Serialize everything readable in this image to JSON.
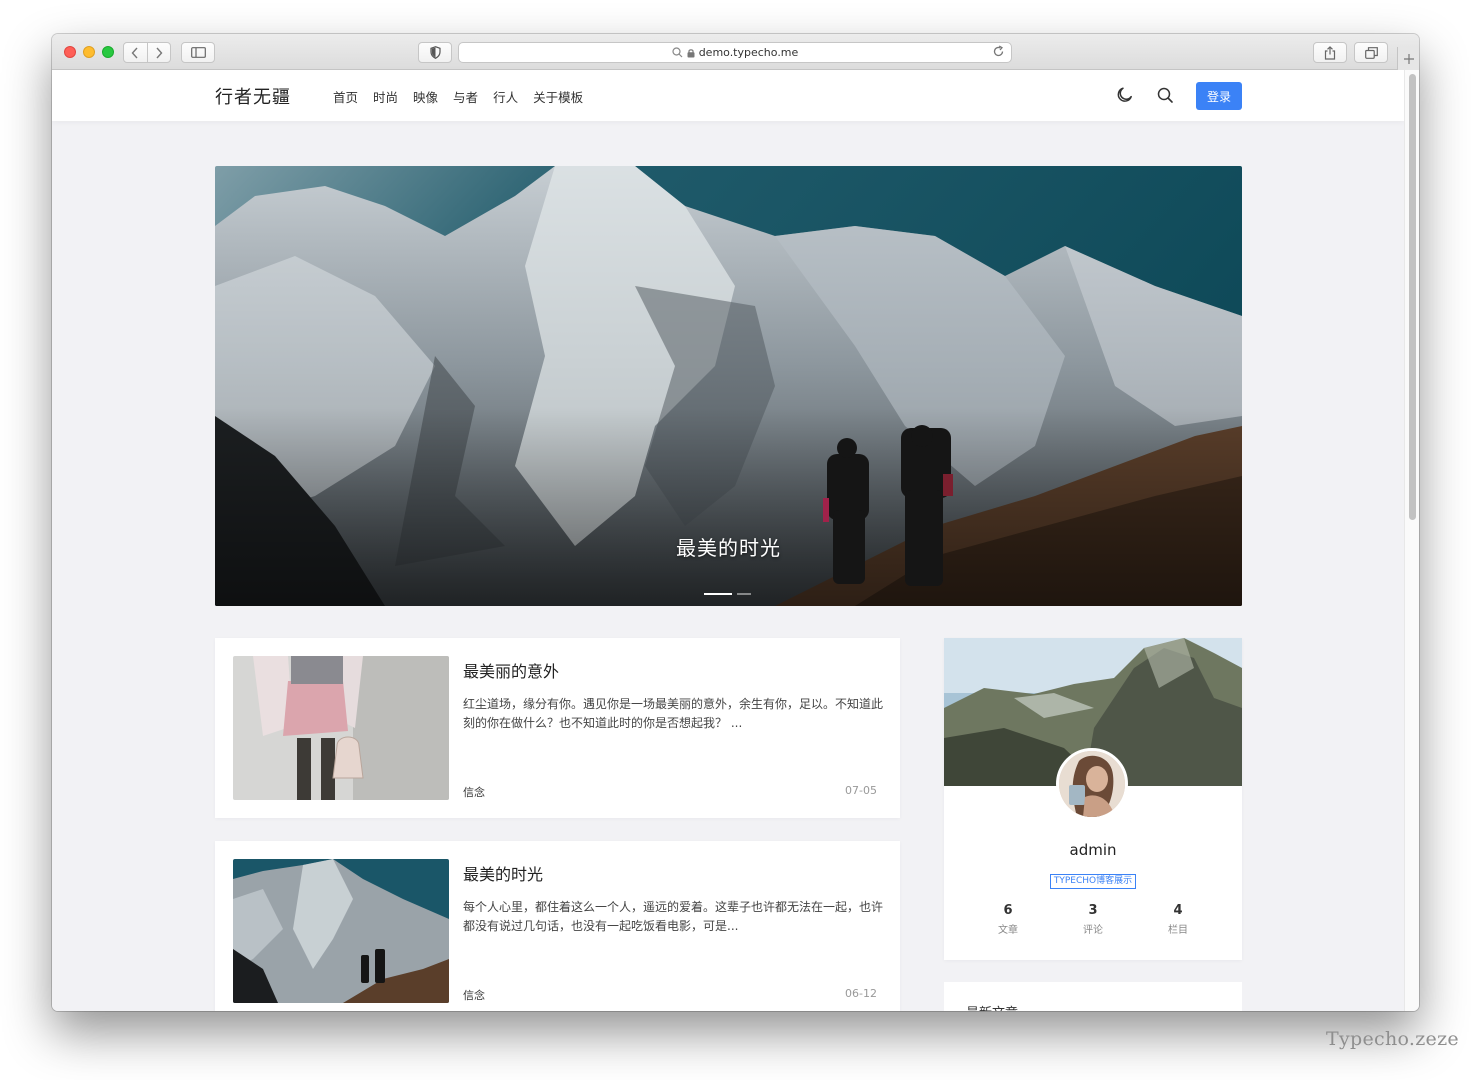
{
  "browser": {
    "url": "demo.typecho.me",
    "icons": [
      "back-icon",
      "forward-icon",
      "sidebar-icon",
      "shield-icon",
      "search-icon",
      "lock-icon",
      "reload-icon",
      "share-icon",
      "tabs-icon",
      "plus-icon"
    ]
  },
  "site": {
    "logo": "行者无疆",
    "nav": [
      "首页",
      "时尚",
      "映像",
      "与者",
      "行人",
      "关于模板"
    ],
    "login_label": "登录",
    "accent_color": "#3b82f6"
  },
  "hero": {
    "title": "最美的时光",
    "slide_count": 2,
    "active_slide": 1
  },
  "posts": [
    {
      "title": "最美丽的意外",
      "excerpt": "红尘道场，缘分有你。遇见你是一场最美丽的意外，余生有你，足以。不知道此刻的你在做什么？也不知道此时的你是否想起我？ ...",
      "tag": "信念",
      "date": "07-05"
    },
    {
      "title": "最美的时光",
      "excerpt": "每个人心里，都住着这么一个人，遥远的爱着。这辈子也许都无法在一起，也许都没有说过几句话，也没有一起吃饭看电影，可是...",
      "tag": "信念",
      "date": "06-12"
    }
  ],
  "profile": {
    "name": "admin",
    "badge": "TYPECHO博客展示",
    "stats": [
      {
        "value": "6",
        "label": "文章"
      },
      {
        "value": "3",
        "label": "评论"
      },
      {
        "value": "4",
        "label": "栏目"
      }
    ]
  },
  "recent": {
    "title": "最新文章"
  },
  "watermark": "Typecho.zeze"
}
